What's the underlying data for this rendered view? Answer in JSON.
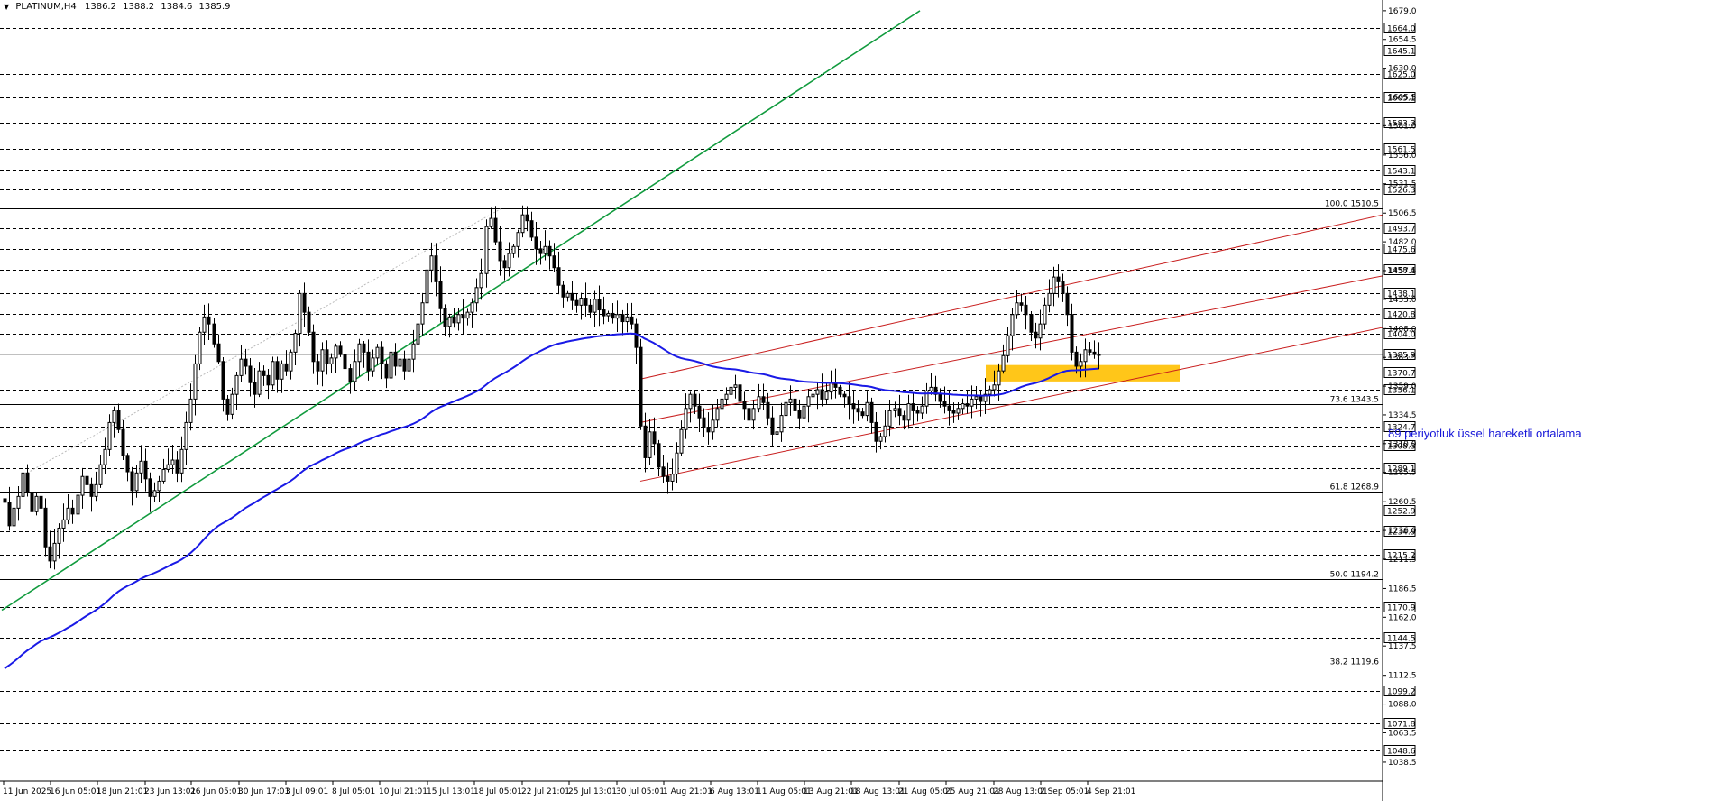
{
  "header": {
    "symbol": "PLATINUM,H4",
    "open": "1386.2",
    "high": "1388.2",
    "low": "1384.6",
    "close": "1385.9",
    "collapse_icon": "triangle-down-icon"
  },
  "annotation": {
    "ema_label": "89 periyotluk üssel hareketli ortalama"
  },
  "colors": {
    "candle": "#000000",
    "ema": "#1a1ae6",
    "trendline": "#119b3e",
    "channel": "#c81e1e",
    "zone": "#ffc000",
    "grid_dash": "#000000",
    "fib": "#000000"
  },
  "chart_data": {
    "type": "candlestick",
    "symbol": "PLATINUM",
    "timeframe": "H4",
    "ylim": [
      1030.0,
      1684.0
    ],
    "y_ticks": [
      "1679.0",
      "1654.5",
      "1630.0",
      "1605.5",
      "1581.0",
      "1556.0",
      "1531.5",
      "1506.5",
      "1482.0",
      "1457.5",
      "1433.0",
      "1408.0",
      "1383.5",
      "1359.0",
      "1334.5",
      "1310.0",
      "1285.5",
      "1260.5",
      "1236.0",
      "1211.5",
      "1186.5",
      "1162.0",
      "1137.5",
      "1112.5",
      "1088.0",
      "1063.5",
      "1038.5"
    ],
    "x_tick_labels": [
      "11 Jun 2025",
      "16 Jun 05:01",
      "18 Jun 21:01",
      "23 Jun 13:01",
      "26 Jun 05:01",
      "30 Jun 17:01",
      "3 Jul 09:01",
      "8 Jul 05:01",
      "10 Jul 21:01",
      "15 Jul 13:01",
      "18 Jul 05:01",
      "22 Jul 21:01",
      "25 Jul 13:01",
      "30 Jul 05:01",
      "1 Aug 21:01",
      "6 Aug 13:01",
      "11 Aug 05:01",
      "13 Aug 21:01",
      "18 Aug 13:01",
      "21 Aug 05:01",
      "25 Aug 21:01",
      "28 Aug 13:01",
      "2 Sep 05:01",
      "4 Sep 21:01"
    ],
    "horizontal_levels": [
      1664.0,
      1645.1,
      1625.0,
      1605.1,
      1583.3,
      1561.5,
      1543.1,
      1526.3,
      1493.7,
      1475.6,
      1458.4,
      1438.1,
      1420.8,
      1404.0,
      1385.9,
      1370.7,
      1356.1,
      1324.7,
      1308.3,
      1289.1,
      1252.9,
      1234.9,
      1215.2,
      1170.9,
      1144.5,
      1099.2,
      1071.8,
      1048.6
    ],
    "fibonacci_levels": [
      {
        "label": "100.0 1510.5",
        "value": 1510.5
      },
      {
        "label": "73.6 1343.5",
        "value": 1343.5
      },
      {
        "label": "61.8 1268.9",
        "value": 1268.9
      },
      {
        "label": "50.0 1194.2",
        "value": 1194.2
      },
      {
        "label": "38.2 1119.6",
        "value": 1119.6
      }
    ],
    "current_price": 1385.9,
    "highlight_zone": {
      "from": 1363.0,
      "to": 1377.0,
      "start": "28 Aug 13:01",
      "end": "4 Sep 21:01"
    },
    "closes": [
      1260,
      1240,
      1255,
      1265,
      1285,
      1268,
      1252,
      1265,
      1255,
      1222,
      1210,
      1225,
      1238,
      1245,
      1255,
      1250,
      1266,
      1282,
      1275,
      1265,
      1275,
      1292,
      1305,
      1328,
      1338,
      1322,
      1300,
      1286,
      1270,
      1285,
      1295,
      1280,
      1265,
      1270,
      1278,
      1288,
      1292,
      1296,
      1285,
      1305,
      1328,
      1348,
      1378,
      1405,
      1418,
      1412,
      1395,
      1380,
      1348,
      1335,
      1352,
      1368,
      1382,
      1376,
      1362,
      1352,
      1372,
      1368,
      1360,
      1380,
      1365,
      1378,
      1372,
      1388,
      1404,
      1438,
      1422,
      1405,
      1380,
      1372,
      1390,
      1378,
      1383,
      1393,
      1386,
      1374,
      1363,
      1380,
      1395,
      1388,
      1372,
      1383,
      1392,
      1378,
      1366,
      1388,
      1376,
      1382,
      1372,
      1382,
      1395,
      1412,
      1430,
      1458,
      1470,
      1448,
      1425,
      1410,
      1418,
      1413,
      1420,
      1417,
      1422,
      1430,
      1443,
      1455,
      1495,
      1502,
      1482,
      1466,
      1460,
      1472,
      1478,
      1490,
      1505,
      1500,
      1486,
      1476,
      1472,
      1478,
      1470,
      1460,
      1445,
      1435,
      1438,
      1432,
      1428,
      1434,
      1428,
      1422,
      1433,
      1424,
      1419,
      1421,
      1417,
      1420,
      1414,
      1418,
      1412,
      1392,
      1325,
      1298,
      1320,
      1310,
      1290,
      1282,
      1278,
      1284,
      1302,
      1322,
      1340,
      1352,
      1342,
      1332,
      1324,
      1320,
      1330,
      1340,
      1348,
      1352,
      1358,
      1360,
      1346,
      1340,
      1330,
      1340,
      1350,
      1345,
      1332,
      1318,
      1320,
      1334,
      1345,
      1348,
      1338,
      1332,
      1342,
      1350,
      1352,
      1356,
      1348,
      1354,
      1362,
      1358,
      1352,
      1350,
      1344,
      1340,
      1337,
      1334,
      1345,
      1328,
      1312,
      1316,
      1325,
      1338,
      1340,
      1334,
      1330,
      1344,
      1338,
      1336,
      1342,
      1355,
      1358,
      1352,
      1346,
      1342,
      1338,
      1336,
      1340,
      1344,
      1342,
      1348,
      1350,
      1346,
      1352,
      1356,
      1360,
      1372,
      1385,
      1402,
      1420,
      1430,
      1428,
      1420,
      1405,
      1400,
      1412,
      1428,
      1438,
      1452,
      1448,
      1438,
      1420,
      1388,
      1376,
      1380,
      1390,
      1388,
      1386,
      1385.9
    ]
  }
}
